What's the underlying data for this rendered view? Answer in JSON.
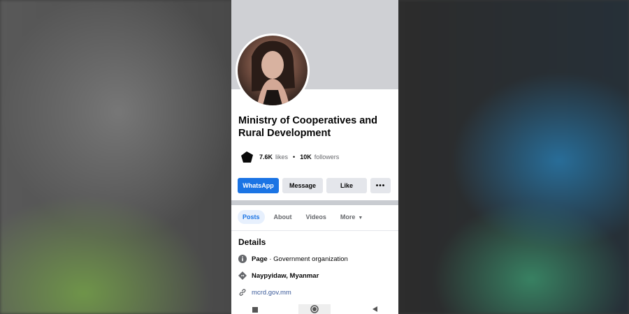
{
  "profile": {
    "name": "Ministry of Cooperatives and Rural Development",
    "likes_count": "7.6K",
    "likes_label": "likes",
    "separator": "•",
    "followers_count": "10K",
    "followers_label": "followers"
  },
  "actions": {
    "whatsapp": "WhatsApp",
    "message": "Message",
    "like": "Like",
    "more": "•••"
  },
  "tabs": [
    {
      "label": "Posts",
      "active": true
    },
    {
      "label": "About",
      "active": false
    },
    {
      "label": "Videos",
      "active": false
    },
    {
      "label": "More",
      "active": false
    }
  ],
  "details": {
    "title": "Details",
    "page_type_prefix": "Page",
    "page_type": " · Government organization",
    "location": "Naypyidaw, Myanmar",
    "website": "mcrd.gov.mm"
  },
  "colors": {
    "accent": "#1b74e4",
    "cover": "#cfd0d4",
    "link": "#385898"
  },
  "icons": {
    "info": "info-icon",
    "location": "location-diamond-icon",
    "link": "link-icon",
    "nav_back": "back-triangle-icon",
    "nav_home": "home-circle-icon",
    "nav_recent": "recent-square-icon"
  }
}
